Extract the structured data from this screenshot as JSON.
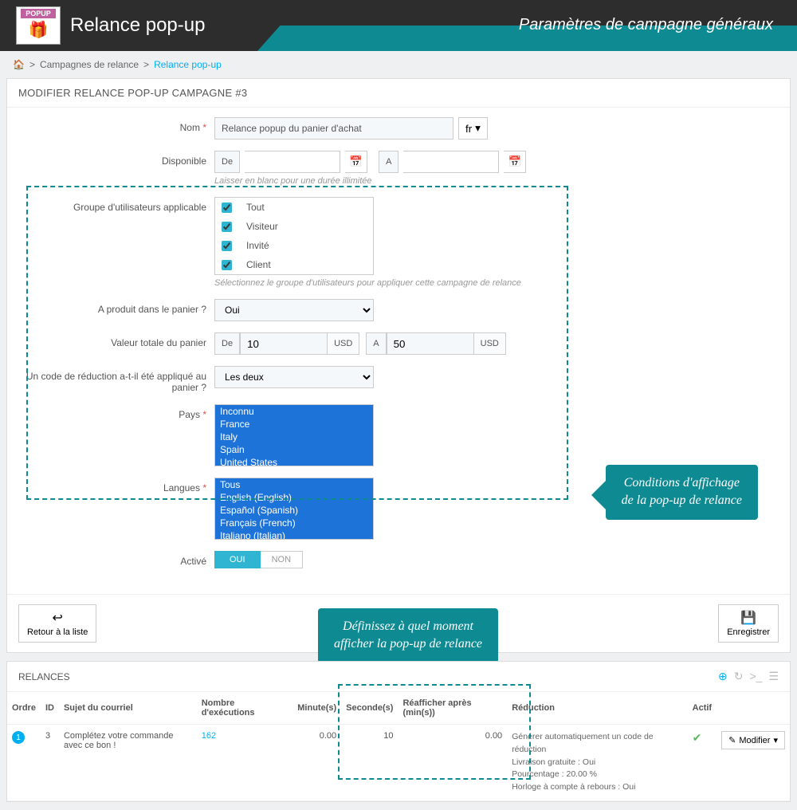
{
  "header": {
    "logo_top": "POPUP",
    "title": "Relance pop-up",
    "subtitle": "Paramètres de campagne généraux"
  },
  "breadcrumb": {
    "home": "⌂",
    "lvl1": "Campagnes de relance",
    "current": "Relance pop-up"
  },
  "form": {
    "heading": "MODIFIER RELANCE POP-UP CAMPAGNE #3",
    "name_label": "Nom",
    "name_value": "Relance popup du panier d'achat",
    "lang": "fr",
    "avail_label": "Disponible",
    "de": "De",
    "a": "A",
    "avail_help": "Laisser en blanc pour une durée illimitée",
    "group_label": "Groupe d'utilisateurs applicable",
    "groups": [
      "Tout",
      "Visiteur",
      "Invité",
      "Client"
    ],
    "group_help": "Sélectionnez le groupe d'utilisateurs pour appliquer cette campagne de relance",
    "hasprod_label": "A produit dans le panier ?",
    "hasprod_val": "Oui",
    "total_label": "Valeur totale du panier",
    "total_from": "10",
    "total_to": "50",
    "usd": "USD",
    "voucher_label": "Un code de réduction a-t-il été appliqué au panier ?",
    "voucher_val": "Les deux",
    "country_label": "Pays",
    "countries": [
      "Inconnu",
      "France",
      "Italy",
      "Spain",
      "United States"
    ],
    "lang_label": "Langues",
    "languages": [
      "Tous",
      "English (English)",
      "Español (Spanish)",
      "Français (French)",
      "Italiano (Italian)"
    ],
    "active_label": "Activé",
    "yes": "OUI",
    "no": "NON",
    "back": "Retour à la liste",
    "save": "Enregistrer"
  },
  "callout1_l1": "Conditions d'affichage",
  "callout1_l2": "de la pop-up de relance",
  "callout2_l1": "Définissez à quel moment",
  "callout2_l2": "afficher la pop-up de relance",
  "relances": {
    "title": "RELANCES",
    "cols": {
      "ordre": "Ordre",
      "id": "ID",
      "sujet": "Sujet du courriel",
      "nb": "Nombre d'exécutions",
      "min": "Minute(s)",
      "sec": "Seconde(s)",
      "reaff": "Réafficher après (min(s))",
      "reduc": "Réduction",
      "actif": "Actif"
    },
    "row": {
      "ordre": "1",
      "id": "3",
      "sujet": "Complétez votre commande avec ce bon !",
      "nb": "162",
      "min": "0.00",
      "sec": "10",
      "reaff": "0.00",
      "reduc1": "Générer automatiquement un code de réduction",
      "reduc2": "Livraison gratuite : Oui",
      "reduc3": "Pourcentage : 20.00 %",
      "reduc4": "Horloge à compte à rebours : Oui",
      "modifier": "Modifier"
    }
  }
}
